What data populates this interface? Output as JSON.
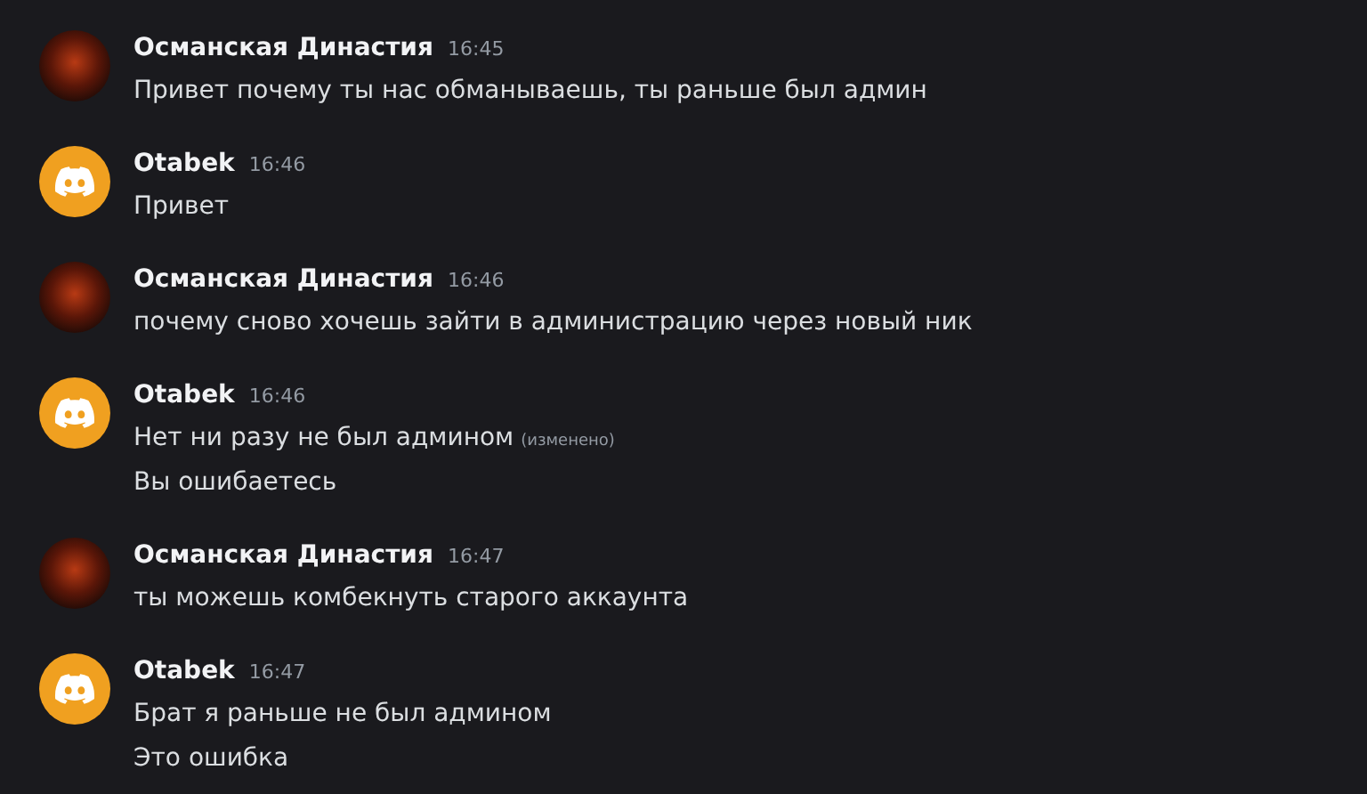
{
  "messages": [
    {
      "author": "Османская Династия",
      "time": "16:45",
      "avatar": {
        "kind": "image"
      },
      "lines": [
        {
          "text": "Привет почему ты нас обманываешь, ты раньше был админ"
        }
      ]
    },
    {
      "author": "Otabek",
      "time": "16:46",
      "avatar": {
        "kind": "discord"
      },
      "lines": [
        {
          "text": "Привет"
        }
      ]
    },
    {
      "author": "Османская Династия",
      "time": "16:46",
      "avatar": {
        "kind": "image"
      },
      "lines": [
        {
          "text": "почему сново хочешь зайти в администрацию через новый ник"
        }
      ]
    },
    {
      "author": "Otabek",
      "time": "16:46",
      "avatar": {
        "kind": "discord"
      },
      "lines": [
        {
          "text": "Нет ни разу не был админом",
          "edited": "(изменено)"
        },
        {
          "text": "Вы ошибаетесь"
        }
      ]
    },
    {
      "author": "Османская Династия",
      "time": "16:47",
      "avatar": {
        "kind": "image"
      },
      "lines": [
        {
          "text": "ты можешь комбекнуть старого аккаунта"
        }
      ]
    },
    {
      "author": "Otabek",
      "time": "16:47",
      "avatar": {
        "kind": "discord"
      },
      "lines": [
        {
          "text": "Брат я раньше не был админом"
        },
        {
          "text": "Это ошибка"
        }
      ]
    }
  ]
}
